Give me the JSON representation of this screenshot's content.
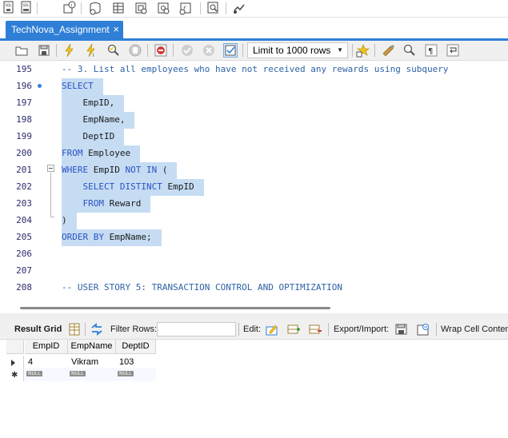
{
  "tab": {
    "title": "TechNova_Assignment",
    "close_glyph": "×"
  },
  "toolbar": {
    "main_icons": [
      "new-sql-tab-icon",
      "open-sql-file-icon",
      "info-icon",
      "create-schema-icon",
      "create-table-icon",
      "create-view-icon",
      "create-procedure-icon",
      "create-function-icon",
      "search-table-icon",
      "reconnect-icon"
    ],
    "limit_select": {
      "value": "Limit to 1000 rows",
      "arrow": "▼"
    }
  },
  "editor": {
    "lines": [
      {
        "num": "195",
        "parts": [
          {
            "t": "-- 3. List all employees who have not received any rewards using subquery",
            "c": "cm"
          }
        ],
        "selected": false
      },
      {
        "num": "196",
        "parts": [
          {
            "t": "SELECT",
            "c": "kw"
          }
        ],
        "selected": true,
        "dot": true
      },
      {
        "num": "197",
        "parts": [
          {
            "t": "    EmpID,",
            "c": "id"
          }
        ],
        "selected": true
      },
      {
        "num": "198",
        "parts": [
          {
            "t": "    EmpName,",
            "c": "id"
          }
        ],
        "selected": true
      },
      {
        "num": "199",
        "parts": [
          {
            "t": "    DeptID",
            "c": "id"
          }
        ],
        "selected": true
      },
      {
        "num": "200",
        "parts": [
          {
            "t": "FROM",
            "c": "kw"
          },
          {
            "t": " Employee",
            "c": "id"
          }
        ],
        "selected": true
      },
      {
        "num": "201",
        "parts": [
          {
            "t": "WHERE",
            "c": "kw"
          },
          {
            "t": " EmpID ",
            "c": "id"
          },
          {
            "t": "NOT IN",
            "c": "kw"
          },
          {
            "t": " (",
            "c": "id"
          }
        ],
        "selected": true,
        "fold": "start"
      },
      {
        "num": "202",
        "parts": [
          {
            "t": "    SELECT DISTINCT",
            "c": "kw"
          },
          {
            "t": " EmpID",
            "c": "id"
          }
        ],
        "selected": true
      },
      {
        "num": "203",
        "parts": [
          {
            "t": "    FROM",
            "c": "kw"
          },
          {
            "t": " Reward",
            "c": "id"
          }
        ],
        "selected": true
      },
      {
        "num": "204",
        "parts": [
          {
            "t": ")",
            "c": "id"
          }
        ],
        "selected": true,
        "fold": "end"
      },
      {
        "num": "205",
        "parts": [
          {
            "t": "ORDER BY",
            "c": "kw"
          },
          {
            "t": " EmpName;",
            "c": "id"
          }
        ],
        "selected": true
      },
      {
        "num": "206",
        "parts": [],
        "selected": false
      },
      {
        "num": "207",
        "parts": [],
        "selected": false
      },
      {
        "num": "208",
        "parts": [
          {
            "t": "-- USER STORY 5: TRANSACTION CONTROL AND OPTIMIZATION",
            "c": "cm"
          }
        ],
        "selected": false
      }
    ]
  },
  "results": {
    "result_grid_label": "Result Grid",
    "filter_rows_label": "Filter Rows:",
    "filter_value": "",
    "edit_label": "Edit:",
    "export_import_label": "Export/Import:",
    "wrap_label": "Wrap Cell Content",
    "columns": [
      "EmpID",
      "EmpName",
      "DeptID"
    ],
    "rows": [
      [
        "4",
        "Vikram",
        "103"
      ]
    ],
    "new_row": [
      "NULL",
      "NULL",
      "NULL"
    ]
  },
  "colors": {
    "accent": "#2f7fd7",
    "selection": "#c5dcf3",
    "keyword": "#2b52c5",
    "comment": "#2e62a5"
  }
}
